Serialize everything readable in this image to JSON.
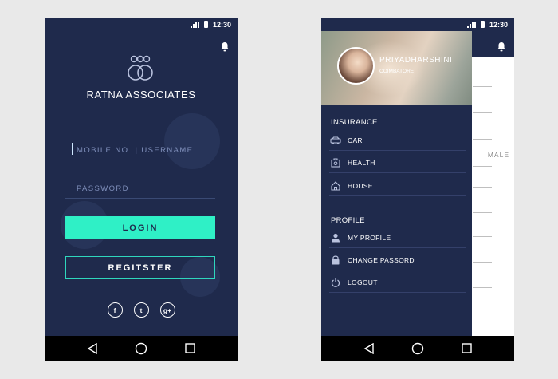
{
  "status": {
    "time": "12:30"
  },
  "login": {
    "brand": "RATNA ASSOCIATES",
    "username_placeholder": "MOBILE NO. | USERNAME",
    "password_placeholder": "PASSWORD",
    "login_label": "LOGIN",
    "register_label": "REGITSTER",
    "socials": [
      {
        "icon": "facebook-icon",
        "glyph": "f"
      },
      {
        "icon": "twitter-icon",
        "glyph": "t"
      },
      {
        "icon": "google-plus-icon",
        "glyph": "g+"
      }
    ]
  },
  "drawer": {
    "profile_name": "PRIYADHARSHINI",
    "profile_city": "COIMBATORE",
    "sections": [
      {
        "title": "INSURANCE",
        "items": [
          {
            "label": "CAR",
            "icon": "car-icon"
          },
          {
            "label": "HEALTH",
            "icon": "health-kit-icon"
          },
          {
            "label": "HOUSE",
            "icon": "house-icon"
          }
        ]
      },
      {
        "title": "PROFILE",
        "items": [
          {
            "label": "MY PROFILE",
            "icon": "user-icon"
          },
          {
            "label": "CHANGE PASSORD",
            "icon": "lock-icon"
          },
          {
            "label": "LOGOUT",
            "icon": "power-icon"
          }
        ]
      }
    ]
  },
  "background_form": {
    "gender_hint": "MALE"
  },
  "colors": {
    "navy": "#1f2a4c",
    "accent": "#2ff0c6",
    "line": "#2fd6bd"
  }
}
